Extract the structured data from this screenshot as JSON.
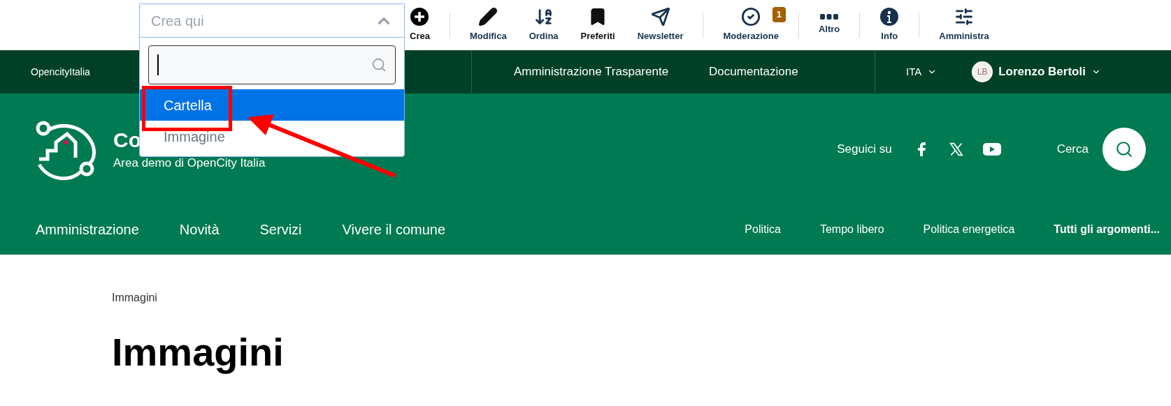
{
  "toolbar": {
    "dropdown": {
      "placeholder": "Crea qui",
      "expanded": true,
      "options": [
        {
          "label": "Cartella",
          "selected": true
        },
        {
          "label": "Immagine",
          "selected": false
        }
      ]
    },
    "actions": [
      {
        "label": "Crea",
        "kind": "plus",
        "separator_after": true
      },
      {
        "label": "Modifica",
        "kind": "pencil",
        "separator_after": false
      },
      {
        "label": "Ordina",
        "kind": "sort",
        "separator_after": false
      },
      {
        "label": "Preferiti",
        "kind": "bookmark",
        "separator_after": false
      },
      {
        "label": "Newsletter",
        "kind": "send",
        "separator_after": true
      },
      {
        "label": "Moderazione",
        "kind": "check",
        "badge": "1",
        "separator_after": true
      },
      {
        "label": "Altro",
        "kind": "more",
        "separator_after": true
      },
      {
        "label": "Info",
        "kind": "info",
        "separator_after": true
      },
      {
        "label": "Amministra",
        "kind": "sliders",
        "separator_after": false
      }
    ]
  },
  "topbar": {
    "brand": "OpencityItalia",
    "links": [
      "Amministrazione Trasparente",
      "Documentazione"
    ],
    "language": "ITA",
    "user": {
      "initials": "LB",
      "name": "Lorenzo Bertoli"
    }
  },
  "header": {
    "title": "Co",
    "subtitle": "Area demo di OpenCity Italia",
    "social_label": "Seguici su",
    "networks": [
      {
        "kind": "facebook"
      },
      {
        "kind": "x"
      },
      {
        "kind": "youtube"
      }
    ],
    "search_label": "Cerca"
  },
  "main_nav": [
    "Amministrazione",
    "Novità",
    "Servizi",
    "Vivere il comune"
  ],
  "topics_nav": [
    {
      "label": "Politica",
      "bold": false
    },
    {
      "label": "Tempo libero",
      "bold": false
    },
    {
      "label": "Politica energetica",
      "bold": false
    },
    {
      "label": "Tutti gli argomenti...",
      "bold": true
    }
  ],
  "breadcrumb": [
    "Immagini"
  ],
  "page_title": "Immagini"
}
